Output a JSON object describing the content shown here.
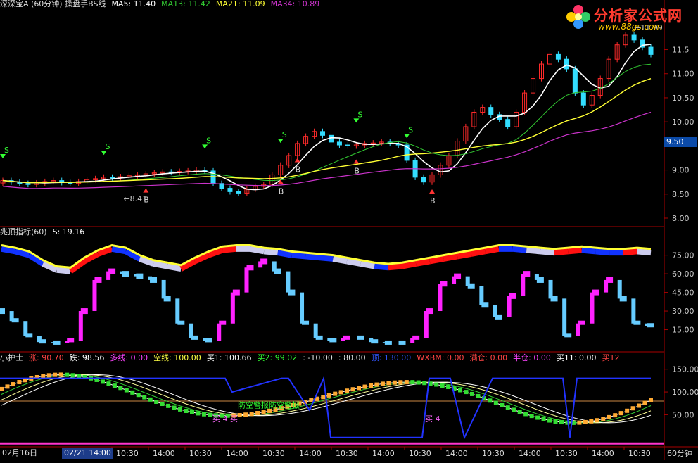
{
  "colors": {
    "background": "#000000",
    "border": "#aa0000",
    "up": "#ff2a2a",
    "down": "#33ddff",
    "ma5": "#ffffff",
    "ma13": "#33cc33",
    "ma21": "#ffff33",
    "ma34": "#cc33cc"
  },
  "logo": {
    "title": "分析家公式网",
    "url": "www.88gs.com"
  },
  "panel1": {
    "header": [
      {
        "text": "深深宝A (60分钟) 操盘手BS线",
        "color": "#dddddd"
      },
      {
        "text": "MA5: 11.40",
        "color": "#ffffff"
      },
      {
        "text": "MA13: 11.42",
        "color": "#33cc33"
      },
      {
        "text": "MA21: 11.09",
        "color": "#ffff33"
      },
      {
        "text": "MA34: 10.89",
        "color": "#cc33cc"
      }
    ],
    "y_ticks": [
      "11.5",
      "11.00",
      "10.50",
      "10.00",
      "9.00",
      "8.50",
      "8.00"
    ],
    "price_box": "9.50",
    "low_label": "8.41",
    "high_label": "11.99"
  },
  "panel2": {
    "header": [
      {
        "text": "兆顶指标(60)",
        "color": "#dddddd"
      },
      {
        "text": "S: 19.16",
        "color": "#ffffff"
      }
    ],
    "y_ticks": [
      "75.00",
      "60.00",
      "45.00",
      "30.00",
      "15.00"
    ]
  },
  "panel3": {
    "header": [
      {
        "text": "小护士",
        "color": "#dddddd"
      },
      {
        "text": "涨: 90.70",
        "color": "#ff4444"
      },
      {
        "text": "跌: 98.56",
        "color": "#ffffff"
      },
      {
        "text": "多线: 0.00",
        "color": "#ff44ff"
      },
      {
        "text": "空线: 100.00",
        "color": "#ffff44"
      },
      {
        "text": "买1: 100.66",
        "color": "#ffffff"
      },
      {
        "text": "买2: 99.02",
        "color": "#33ff33"
      },
      {
        "text": ": -10.00",
        "color": "#dddddd"
      },
      {
        "text": ": 80.00",
        "color": "#dddddd"
      },
      {
        "text": "顶: 130.00",
        "color": "#3355ff"
      },
      {
        "text": "WXBM: 0.00",
        "color": "#ff4444"
      },
      {
        "text": "满仓: 0.00",
        "color": "#ff4444"
      },
      {
        "text": "半仓: 0.00",
        "color": "#ff44ff"
      },
      {
        "text": "买11: 0.00",
        "color": "#ffffff"
      },
      {
        "text": "买12",
        "color": "#ff4444"
      }
    ],
    "y_ticks": [
      "150.00",
      "100.00",
      "50.00"
    ],
    "annotations": [
      "防空警报",
      "防空警报",
      "买 4 买",
      "买 4"
    ]
  },
  "time_axis": {
    "date_start": "02月16日",
    "date_box": "02/21 14:00",
    "labels": [
      "10:30",
      "14:00",
      "10:30",
      "14:00",
      "10:30",
      "14:00",
      "10:30",
      "14:00",
      "10:30",
      "14:00",
      "10:30",
      "14:00",
      "10:30",
      "14:00",
      "10:30"
    ],
    "corner": "60分钟"
  },
  "chart_data": {
    "type": "line",
    "title": "深深宝A (60分钟) 操盘手BS线",
    "series": [
      {
        "name": "MA5",
        "last": 11.4
      },
      {
        "name": "MA13",
        "last": 11.42
      },
      {
        "name": "MA21",
        "last": 11.09
      },
      {
        "name": "MA34",
        "last": 10.89
      }
    ],
    "close": [
      8.78,
      8.75,
      8.72,
      8.7,
      8.73,
      8.76,
      8.78,
      8.74,
      8.72,
      8.76,
      8.8,
      8.82,
      8.85,
      8.84,
      8.86,
      8.88,
      8.9,
      8.92,
      8.94,
      8.96,
      8.95,
      8.97,
      8.98,
      9.0,
      8.98,
      8.72,
      8.62,
      8.55,
      8.52,
      8.6,
      8.66,
      8.7,
      8.9,
      9.1,
      9.3,
      9.55,
      9.7,
      9.8,
      9.72,
      9.58,
      9.52,
      9.5,
      9.52,
      9.55,
      9.56,
      9.58,
      9.55,
      9.52,
      9.2,
      8.85,
      8.75,
      8.9,
      9.1,
      9.3,
      9.6,
      9.9,
      10.2,
      10.3,
      10.15,
      10.05,
      9.9,
      10.2,
      10.6,
      10.9,
      11.2,
      11.4,
      11.3,
      11.1,
      10.6,
      10.35,
      10.55,
      10.9,
      11.3,
      11.6,
      11.8,
      11.7,
      11.55,
      11.4
    ],
    "signals": [
      {
        "type": "S",
        "index": 0
      },
      {
        "type": "S",
        "index": 24
      },
      {
        "type": "B",
        "index": 33
      },
      {
        "type": "S",
        "index": 47
      },
      {
        "type": "S",
        "index": 63
      },
      {
        "type": "B",
        "index": 64
      },
      {
        "type": "B",
        "index": 71
      },
      {
        "type": "S",
        "index": 84
      },
      {
        "type": "S",
        "index": 100
      },
      {
        "type": "B",
        "index": 102
      },
      {
        "type": "B",
        "index": 116
      },
      {
        "type": "S",
        "index": 112
      }
    ],
    "indicator_S": 19.16,
    "xiaohushi": {
      "涨": 90.7,
      "跌": 98.56,
      "多线": 0.0,
      "空线": 100.0,
      "买1": 100.66,
      "买2": 99.02,
      "顶": 130.0
    }
  }
}
